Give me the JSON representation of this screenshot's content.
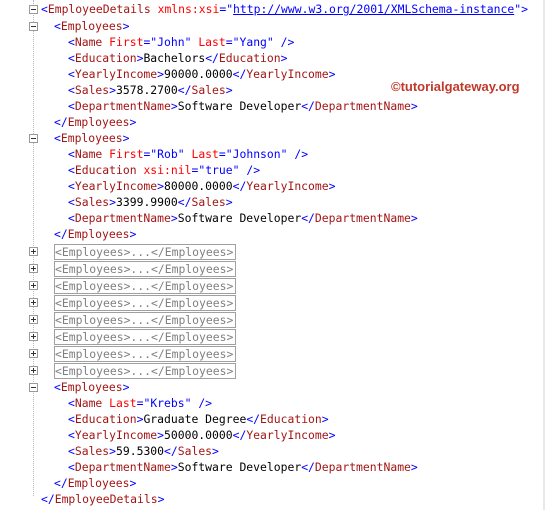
{
  "watermark": "©tutorialgateway.org",
  "root": {
    "open_tag": "EmployeeDetails",
    "attr_name": "xmlns:xsi",
    "attr_value": "http://www.w3.org/2001/XMLSchema-instance",
    "close_tag": "EmployeeDetails"
  },
  "employees": [
    {
      "name_first": "John",
      "name_last": "Yang",
      "education": "Bachelors",
      "yearly_income": "90000.0000",
      "sales": "3578.2700",
      "department": "Software Developer"
    },
    {
      "name_first": "Rob",
      "name_last": "Johnson",
      "education_nil": "true",
      "yearly_income": "80000.0000",
      "sales": "3399.9900",
      "department": "Software Developer"
    },
    {
      "name_last": "Krebs",
      "education": "Graduate Degree",
      "yearly_income": "50000.0000",
      "sales": "59.5300",
      "department": "Software Developer"
    }
  ],
  "collapsed_rows": [
    "<Employees>...</Employees>",
    "<Employees>...</Employees>",
    "<Employees>...</Employees>",
    "<Employees>...</Employees>",
    "<Employees>...</Employees>",
    "<Employees>...</Employees>",
    "<Employees>...</Employees>",
    "<Employees>...</Employees>"
  ],
  "tags": {
    "employees": "Employees",
    "name": "Name",
    "first": "First",
    "last": "Last",
    "education": "Education",
    "xsi_nil": "xsi:nil",
    "yearly_income": "YearlyIncome",
    "sales": "Sales",
    "department": "DepartmentName"
  }
}
